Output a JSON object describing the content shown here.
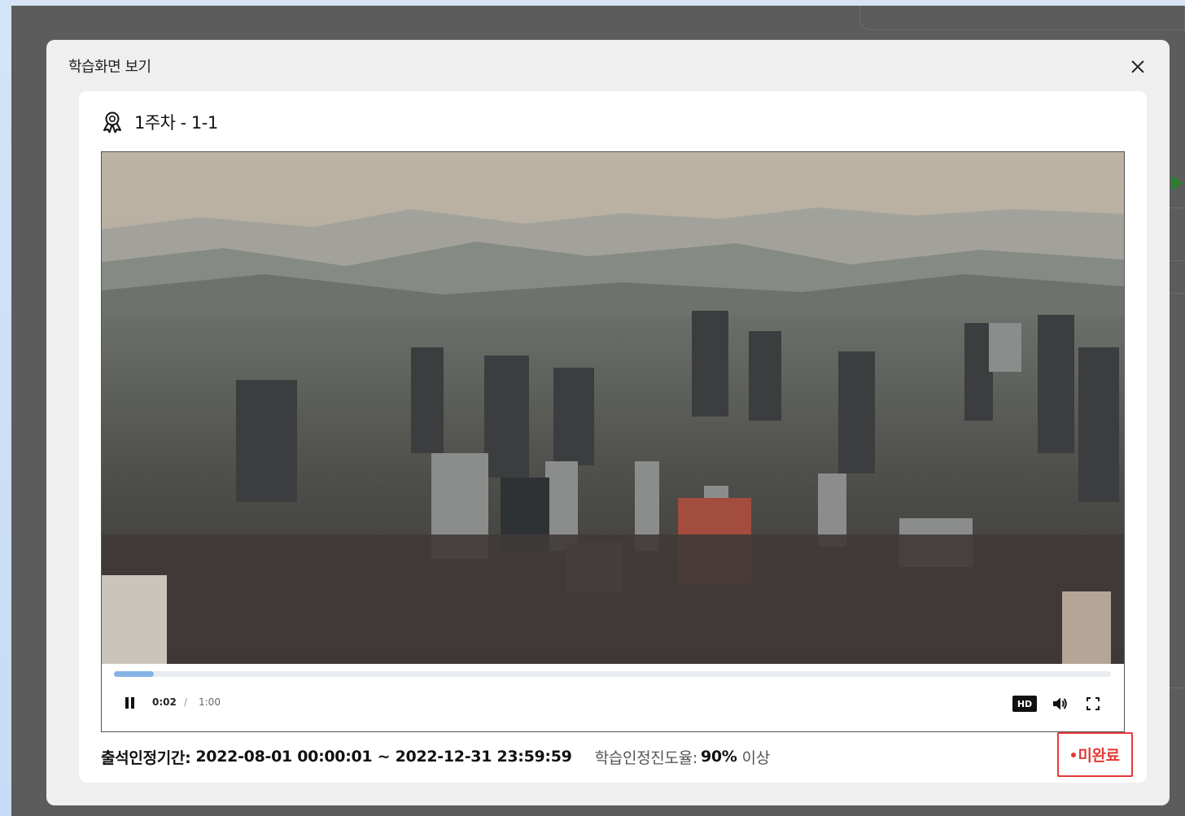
{
  "modal": {
    "title": "학습화면 보기",
    "close_icon": "close-icon"
  },
  "lesson": {
    "icon": "award-ribbon-icon",
    "title": "1주차 - 1-1"
  },
  "player": {
    "video_description": "Aerial view of a hazy city skyline with high-rise towers and mountains",
    "progress_fraction": 0.04,
    "state": "playing",
    "time_current": "0:02",
    "time_separator": "/",
    "time_total": "1:00",
    "quality_label": "HD",
    "icons": {
      "pause": "pause-icon",
      "volume": "volume-icon",
      "fullscreen": "fullscreen-icon"
    }
  },
  "info": {
    "period_label": "출석인정기간:",
    "period_value": "2022-08-01 00:00:01 ~ 2022-12-31 23:59:59",
    "rate_label": "학습인정진도율:",
    "rate_value": "90%",
    "rate_suffix": "이상"
  },
  "status": {
    "label": "미완료",
    "color": "#e53935"
  },
  "colors": {
    "overlay": "#5c5c5c",
    "modal_bg": "#efefef",
    "progress_fill": "#86b4e6",
    "accent_alert": "#e53935"
  }
}
